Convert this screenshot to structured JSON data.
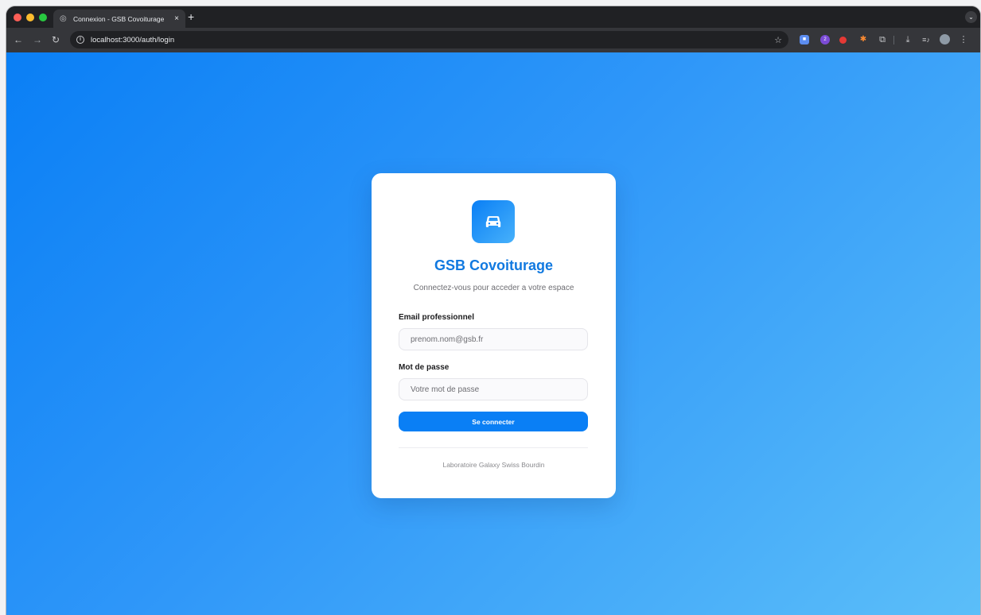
{
  "browser": {
    "tab_title": "Connexion - GSB Covoiturage",
    "tab_close": "×",
    "new_tab": "+",
    "url": "localhost:3000/auth/login",
    "icons": [
      "globe-icon",
      "close-icon",
      "plus-icon",
      "back-arrow-icon",
      "forward-arrow-icon",
      "reload-icon",
      "info-icon",
      "star-icon",
      "shield-icon",
      "badge-icon",
      "puzzle-icon",
      "download-icon",
      "media-icon",
      "menu-icon"
    ],
    "extension_badge_count": "2"
  },
  "login": {
    "title": "GSB Covoiturage",
    "subtitle": "Connectez-vous pour acceder a votre espace",
    "email_label": "Email professionnel",
    "email_placeholder": "prenom.nom@gsb.fr",
    "password_label": "Mot de passe",
    "password_placeholder": "Votre mot de passe",
    "submit_label": "Se connecter",
    "footer": "Laboratoire Galaxy Swiss Bourdin"
  },
  "colors": {
    "accent": "#0a7ff5",
    "title": "#1179e0",
    "card": "#ffffff"
  }
}
